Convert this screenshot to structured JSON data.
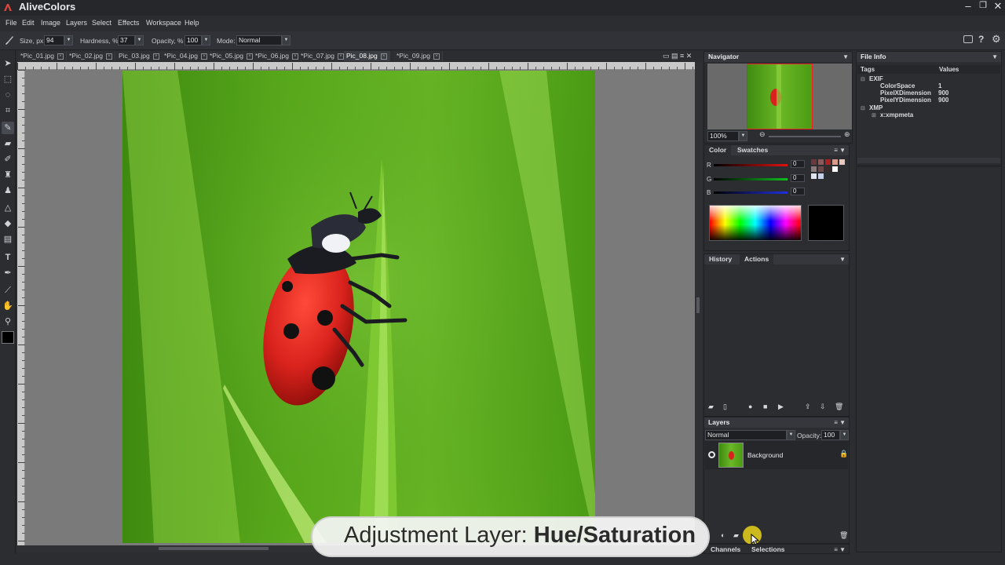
{
  "app": {
    "title": "AliveColors"
  },
  "menu": [
    "File",
    "Edit",
    "Image",
    "Layers",
    "Select",
    "Effects",
    "Workspace",
    "Help"
  ],
  "options": {
    "size_label": "Size, px",
    "size_value": "94",
    "hardness_label": "Hardness, %",
    "hardness_value": "37",
    "opacity_label": "Opacity, %",
    "opacity_value": "100",
    "mode_label": "Mode:",
    "mode_value": "Normal"
  },
  "tabs": [
    "*Pic_01.jpg",
    "*Pic_02.jpg",
    "Pic_03.jpg",
    "*Pic_04.jpg",
    "*Pic_05.jpg",
    "*Pic_06.jpg",
    "*Pic_07.jpg",
    "Pic_08.jpg",
    "*Pic_09.jpg"
  ],
  "active_tab": "Pic_08.jpg",
  "navigator": {
    "title": "Navigator",
    "zoom": "100%"
  },
  "color_panel": {
    "tabs": [
      "Color",
      "Swatches"
    ],
    "r_label": "R",
    "g_label": "G",
    "b_label": "B",
    "r_value": "0",
    "g_value": "0",
    "b_value": "0",
    "current_color": "#000000"
  },
  "history_panel": {
    "tabs": [
      "History",
      "Actions"
    ]
  },
  "layers_panel": {
    "title": "Layers",
    "blend_mode": "Normal",
    "opacity_label": "Opacity:",
    "opacity_value": "100",
    "layers": [
      {
        "name": "Background"
      }
    ]
  },
  "bottom_tabs": [
    "Channels",
    "Selections"
  ],
  "file_info": {
    "title": "File Info",
    "col_tags": "Tags",
    "col_values": "Values",
    "rows": [
      {
        "tag": "EXIF",
        "value": ""
      },
      {
        "tag": "ColorSpace",
        "value": "1"
      },
      {
        "tag": "PixelXDimension",
        "value": "900"
      },
      {
        "tag": "PixelYDimension",
        "value": "900"
      },
      {
        "tag": "XMP",
        "value": ""
      },
      {
        "tag": "x:xmpmeta",
        "value": ""
      }
    ]
  },
  "caption": {
    "prefix": "Adjustment Layer:",
    "highlight": "Hue/Saturation"
  },
  "colors": {
    "accent_yellow": "#e8d21a",
    "ladybug_red": "#d8221c",
    "grass_green": "#5fb21e"
  }
}
